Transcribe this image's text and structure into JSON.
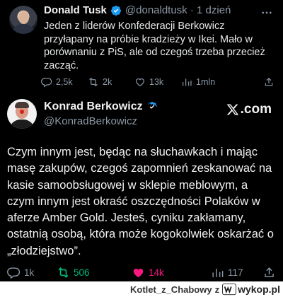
{
  "quoted": {
    "name": "Donald Tusk",
    "handle": "@donaldtusk · 1 dzień",
    "text": "Jeden z liderów Konfederacji Berkowicz przyłapany na próbie kradzieży w Ikei. Mało w porównaniu z PiS, ale od czegoś trzeba przecież zacząć.",
    "stats": {
      "replies": "2,5k",
      "retweets": "2k",
      "likes": "13k",
      "views": "1mln"
    }
  },
  "post": {
    "name": "Konrad Berkowicz",
    "handle": "@KonradBerkowicz",
    "platform": ".com",
    "text": "Czym innym jest, będąc na słuchawkach i mając masę zakupów, czegoś zapomnień zeskanować na kasie samoobsługowej w sklepie meblowym, a czym innym jest okraść oszczędności Polaków w aferze Amber Gold. Jesteś, cyniku zakłamany, ostatnią osobą, która może kogokolwiek oskarżać o „złodziejstwo”.",
    "stats": {
      "replies": "1k",
      "retweets": "506",
      "likes": "14k",
      "views": "117"
    }
  },
  "footer": {
    "user": "Kotlet_z_Chabowy",
    "separator": "z",
    "brand": "wykop.pl"
  },
  "colors": {
    "verified": "#1d9bf0",
    "retweet": "#00ba7c",
    "like": "#f91880",
    "muted": "#8b98a5"
  }
}
